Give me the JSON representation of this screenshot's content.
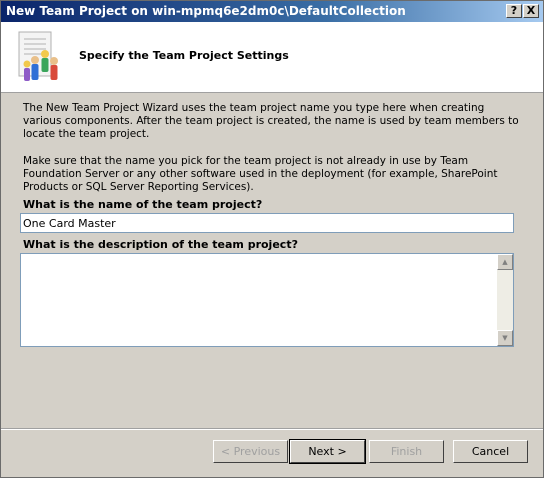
{
  "window": {
    "title": "New Team Project on win-mpmq6e2dm0c\\DefaultCollection",
    "help_label": "?",
    "close_label": "X"
  },
  "header": {
    "title": "Specify the Team Project Settings",
    "icon": "team-wizard-icon"
  },
  "body": {
    "paragraph1": "The New Team Project Wizard uses the team project name you type here when creating various components. After the team project is created, the name is used by team members to locate the team project.",
    "paragraph2": "Make sure that the name you pick for the team project is not already in use by Team Foundation Server or any other software used in the deployment (for example, SharePoint Products or SQL Server Reporting Services).",
    "name_label": "What is the name of the team project?",
    "name_value": "One Card Master",
    "description_label": "What is the description of the team project?",
    "description_value": ""
  },
  "buttons": {
    "previous": "< Previous",
    "next": "Next >",
    "finish": "Finish",
    "cancel": "Cancel"
  },
  "scrollbar": {
    "up_glyph": "▲",
    "down_glyph": "▼"
  }
}
